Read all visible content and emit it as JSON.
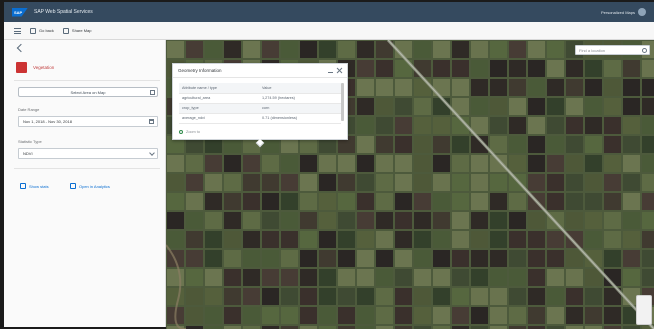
{
  "shell": {
    "app_title": "SAP Web Spatial Services",
    "user": "Personalized Maps"
  },
  "toolbar": {
    "back_label": "Go back",
    "share_label": "Share Map"
  },
  "panel": {
    "layer_name": "Vegetation",
    "action_button": "Select Area on Map",
    "date_range_label": "Date Range",
    "date_range_value": "Nov 1, 2018 - Nov 30, 2018",
    "dropdown_label": "Statistic Type",
    "dropdown_value": "NDVI",
    "link_1": "Show stats",
    "link_2": "Open in Analytics"
  },
  "map": {
    "search_placeholder": "Find a location"
  },
  "popup": {
    "title": "Geometry Information",
    "rows": [
      {
        "key": "Attribute name / type",
        "value": "Value"
      },
      {
        "key": "agricultural_area",
        "value": "1,274.59 (hectares)"
      },
      {
        "key": "crop_type",
        "value": "corn"
      },
      {
        "key": "average_ndvi",
        "value": "0.71 (dimensionless)"
      }
    ],
    "zoom_label": "Zoom to"
  },
  "colors": {
    "shell": "#354a5f",
    "accent": "#0a6ed1",
    "layer": "#cc3333"
  }
}
